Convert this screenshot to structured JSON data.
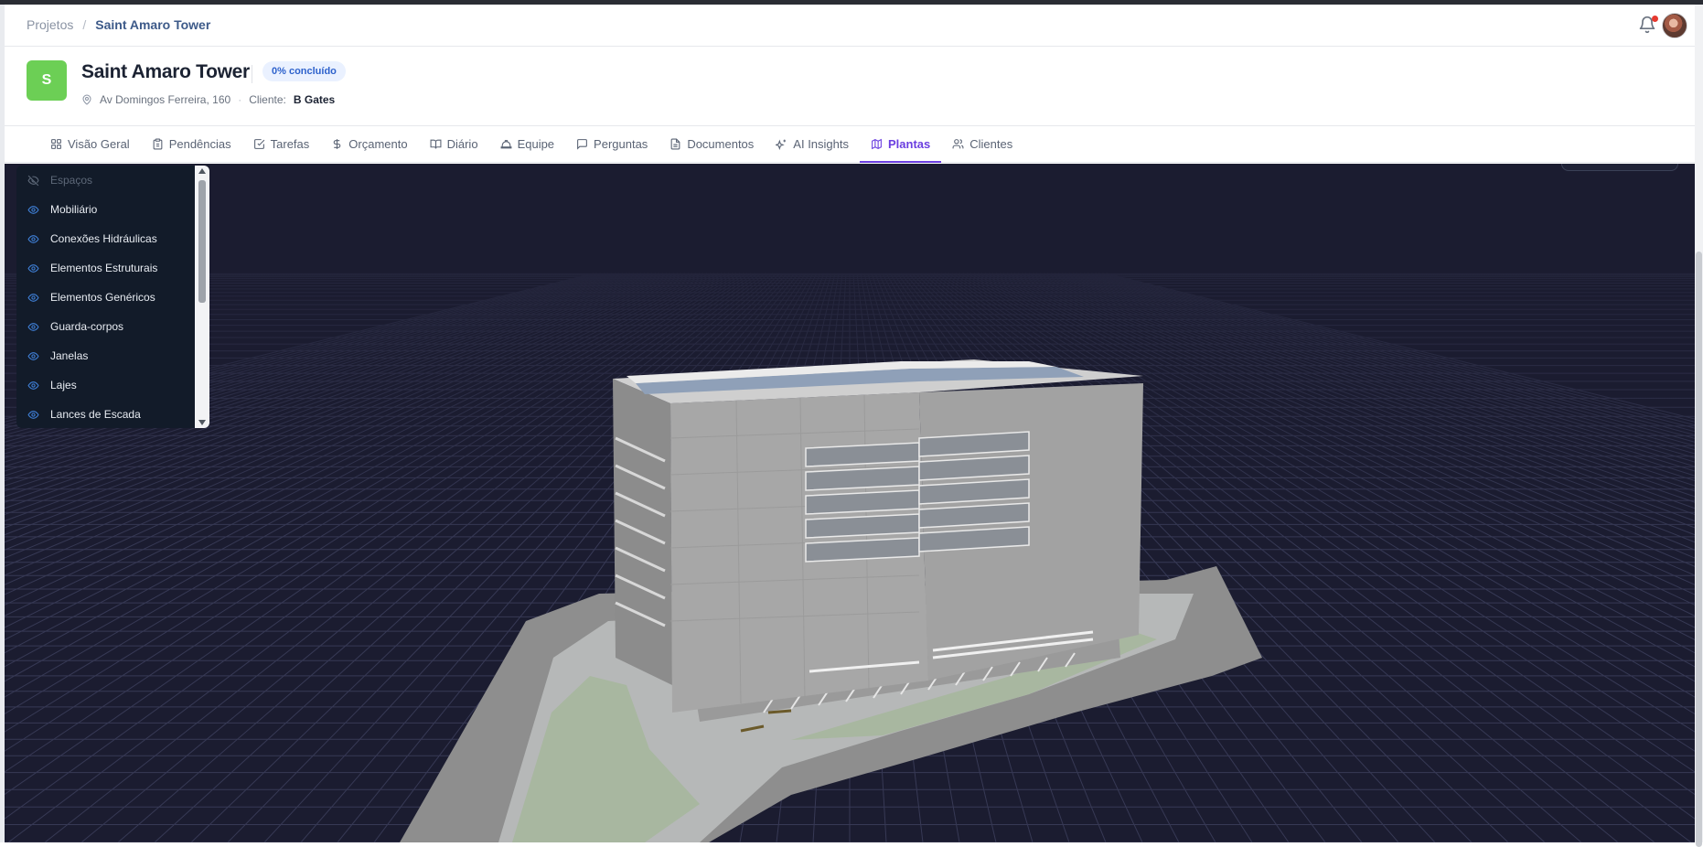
{
  "breadcrumb": {
    "parent": "Projetos",
    "separator": "/",
    "current": "Saint Amaro Tower"
  },
  "project": {
    "initial": "S",
    "name": "Saint Amaro Tower",
    "progress_badge": "0% concluído",
    "address": "Av Domingos Ferreira, 160",
    "client_label": "Cliente:",
    "client_name": "B Gates"
  },
  "tabs": [
    {
      "label": "Visão Geral",
      "icon": "grid-icon"
    },
    {
      "label": "Pendências",
      "icon": "clipboard-icon"
    },
    {
      "label": "Tarefas",
      "icon": "check-square-icon"
    },
    {
      "label": "Orçamento",
      "icon": "dollar-icon"
    },
    {
      "label": "Diário",
      "icon": "book-icon"
    },
    {
      "label": "Equipe",
      "icon": "hardhat-icon"
    },
    {
      "label": "Perguntas",
      "icon": "message-icon"
    },
    {
      "label": "Documentos",
      "icon": "file-icon"
    },
    {
      "label": "AI Insights",
      "icon": "sparkles-icon"
    },
    {
      "label": "Plantas",
      "icon": "map-icon"
    },
    {
      "label": "Clientes",
      "icon": "users-icon"
    }
  ],
  "active_tab": "Plantas",
  "layers": [
    {
      "label": "Espaços",
      "visible": false
    },
    {
      "label": "Mobiliário",
      "visible": true
    },
    {
      "label": "Conexões Hidráulicas",
      "visible": true
    },
    {
      "label": "Elementos Estruturais",
      "visible": true
    },
    {
      "label": "Elementos Genéricos",
      "visible": true
    },
    {
      "label": "Guarda-corpos",
      "visible": true
    },
    {
      "label": "Janelas",
      "visible": true
    },
    {
      "label": "Lajes",
      "visible": true
    },
    {
      "label": "Lances de Escada",
      "visible": true
    }
  ],
  "colors": {
    "accent": "#6b3fe0",
    "viewer_bg": "#1b1c30",
    "logo_bg": "#6ccf55",
    "badge_text": "#2e62cc"
  }
}
